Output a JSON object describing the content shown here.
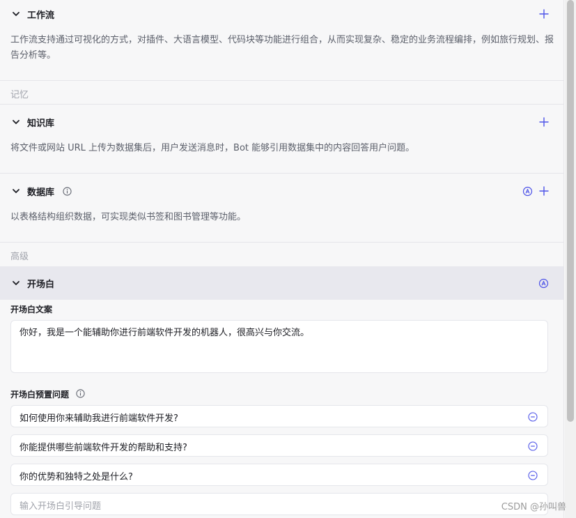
{
  "workflow": {
    "title": "工作流",
    "description": "工作流支持通过可视化的方式，对插件、大语言模型、代码块等功能进行组合，从而实现复杂、稳定的业务流程编排，例如旅行规划、报告分析等。"
  },
  "memory_group": {
    "label": "记忆"
  },
  "knowledge": {
    "title": "知识库",
    "description": "将文件或网站 URL 上传为数据集后，用户发送消息时，Bot 能够引用数据集中的内容回答用户问题。"
  },
  "database": {
    "title": "数据库",
    "description": "以表格结构组织数据，可实现类似书签和图书管理等功能。"
  },
  "advanced_group": {
    "label": "高级"
  },
  "opening": {
    "title": "开场白",
    "text_label": "开场白文案",
    "text_value": "你好，我是一个能辅助你进行前端软件开发的机器人，很高兴与你交流。",
    "questions_label": "开场白预置问题",
    "questions": [
      "如何使用你来辅助我进行前端软件开发?",
      "你能提供哪些前端软件开发的帮助和支持?",
      "你的优势和独特之处是什么?"
    ],
    "input_placeholder": "输入开场白引导问题"
  },
  "watermark": "CSDN @孙叫兽",
  "colors": {
    "accent": "#4d53e8",
    "header_bg": "#e8e8ee"
  },
  "icons": {
    "chevron": "chevron-down-icon",
    "add": "plus-icon",
    "info": "info-icon",
    "auto": "auto-a-icon",
    "remove": "minus-circle-icon"
  }
}
